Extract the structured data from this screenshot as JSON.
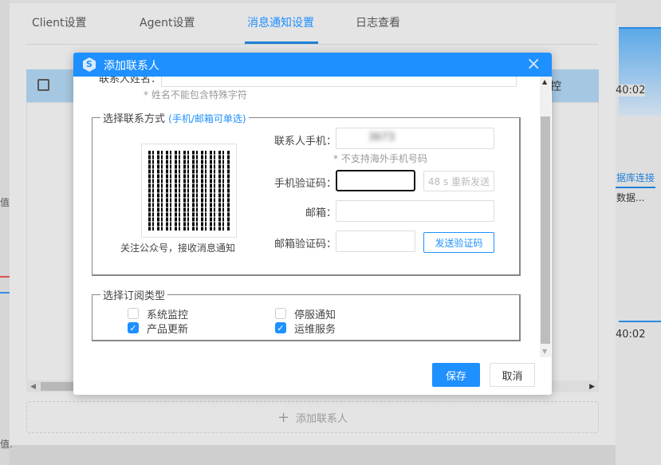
{
  "tabs": [
    {
      "label": "Client设置"
    },
    {
      "label": "Agent设置"
    },
    {
      "label": "消息通知设置"
    },
    {
      "label": "日志查看"
    }
  ],
  "table": {
    "header_partial": "控"
  },
  "add_contact_label": "添加联系人",
  "right_panel": {
    "time1": "40:02",
    "time2": "40:02",
    "tab": "据库连接",
    "text": "数据..."
  },
  "left_panel": {
    "label1": "值:",
    "label2": "值:"
  },
  "modal": {
    "title": "添加联系人",
    "name_label": "联系人姓名：",
    "name_hint": "* 姓名不能包含特殊字符",
    "contact_legend": "选择联系方式",
    "contact_legend_note": "(手机/邮箱可单选)",
    "qr_caption": "关注公众号，接收消息通知",
    "phone_label": "联系人手机：",
    "phone_value": "3673",
    "phone_hint": "* 不支持海外手机号码",
    "sms_code_label": "手机验证码：",
    "resend_button": "48 s 重新发送",
    "email_label": "邮箱：",
    "email_code_label": "邮箱验证码：",
    "send_code_button": "发送验证码",
    "subscribe_legend": "选择订阅类型",
    "subscriptions": [
      {
        "label": "系统监控",
        "checked": false
      },
      {
        "label": "停服通知",
        "checked": false
      },
      {
        "label": "产品更新",
        "checked": true
      },
      {
        "label": "运维服务",
        "checked": true
      }
    ],
    "save_button": "保存",
    "cancel_button": "取消",
    "accent": "#1e90ff"
  }
}
